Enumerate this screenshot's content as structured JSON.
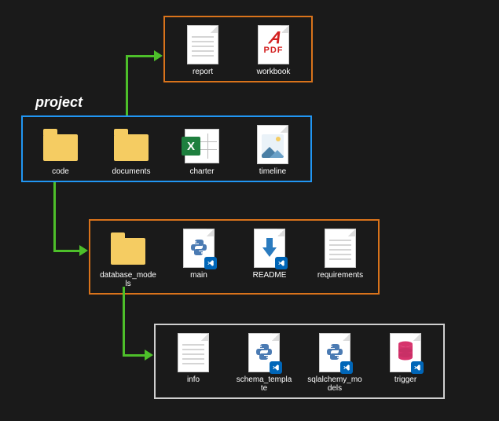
{
  "title": "project",
  "groups": {
    "documents": {
      "items": [
        "report",
        "workbook"
      ]
    },
    "project": {
      "items": [
        "code",
        "documents",
        "charter",
        "timeline"
      ]
    },
    "code": {
      "items": [
        "database_models",
        "main",
        "README",
        "requirements"
      ]
    },
    "database_models": {
      "items": [
        "info",
        "schema_template",
        "sqlalchemy_models",
        "trigger"
      ]
    }
  }
}
